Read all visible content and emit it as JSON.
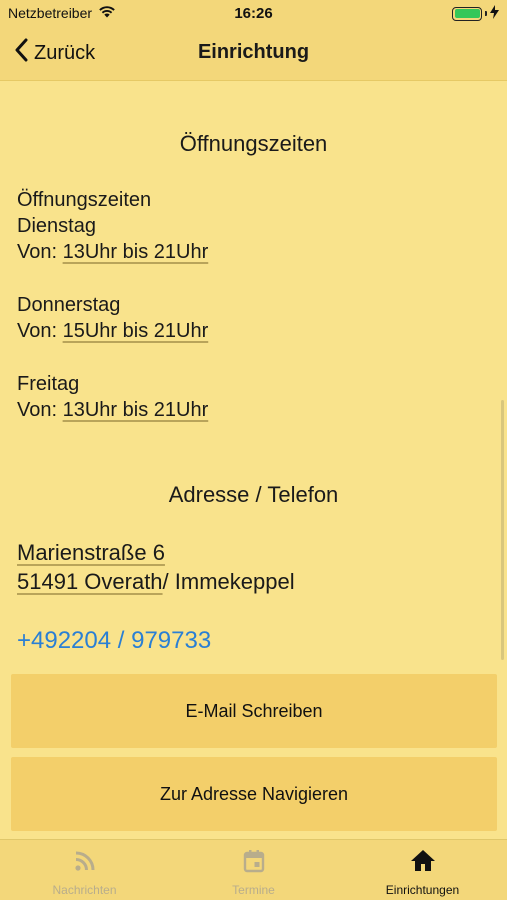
{
  "status_bar": {
    "carrier": "Netzbetreiber",
    "time": "16:26",
    "battery_level": 1.0
  },
  "nav": {
    "back_label": "Zurück",
    "title": "Einrichtung"
  },
  "opening_hours": {
    "heading": "Öffnungszeiten",
    "intro": "Öffnungszeiten",
    "days": [
      {
        "day": "Dienstag",
        "prefix": "Von: ",
        "hours": "13Uhr bis 21Uhr"
      },
      {
        "day": "Donnerstag",
        "prefix": "Von: ",
        "hours": "15Uhr bis 21Uhr"
      },
      {
        "day": "Freitag",
        "prefix": "Von: ",
        "hours": "13Uhr bis 21Uhr"
      }
    ]
  },
  "address": {
    "heading": "Adresse / Telefon",
    "street": "Marienstraße 6",
    "city_linked": "51491 Overath",
    "city_rest": "/ Immekeppel",
    "phone": "+492204 / 979733"
  },
  "buttons": {
    "email": "E-Mail Schreiben",
    "navigate": "Zur Adresse Navigieren"
  },
  "tabs": [
    {
      "label": "Nachrichten",
      "icon": "rss-icon",
      "active": false
    },
    {
      "label": "Termine",
      "icon": "calendar-icon",
      "active": false
    },
    {
      "label": "Einrichtungen",
      "icon": "home-icon",
      "active": true
    }
  ],
  "colors": {
    "background": "#f9e38c",
    "bar": "#f3d77a",
    "button": "#f3cf6a",
    "link": "#2a7fd4",
    "battery": "#34c759"
  }
}
